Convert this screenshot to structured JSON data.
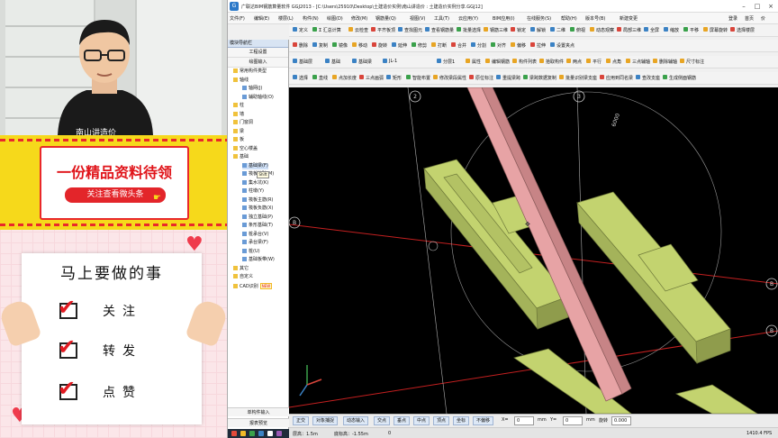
{
  "window": {
    "title": "广联达BIM钢筋算量软件 GGJ2013 - [C:\\Users\\25910\\Desktop\\土建造价实例\\南山讲造价 : 土建造价实例分享.GGJ12]",
    "controls": [
      "–",
      "□",
      "×"
    ]
  },
  "menu": [
    "文件(F)",
    "编辑(E)",
    "楼层(L)",
    "构件(N)",
    "绘图(D)",
    "修改(M)",
    "钢筋量(Q)",
    "视图(V)",
    "工具(T)",
    "云应用(Y)",
    "BIM应用(I)",
    "在线服务(S)",
    "帮助(H)",
    "版本号(B)",
    "新建变更"
  ],
  "menu_right": [
    "登录",
    "首页",
    "价"
  ],
  "toolbar1": [
    "定义",
    "Σ 汇总计算",
    "云检查",
    "平齐板顶",
    "查找图元",
    "查看钢筋量",
    "批量选择",
    "钢筋三维",
    "锁定",
    "解锁",
    "二维",
    "俯视",
    "动态观察",
    "局部三维",
    "全屏",
    "缩放",
    "平移",
    "屏幕旋转",
    "选择楼层"
  ],
  "toolbar2": [
    "删除",
    "复制",
    "镜像",
    "移动",
    "旋转",
    "延伸",
    "修剪",
    "打断",
    "合并",
    "分割",
    "对齐",
    "偏移",
    "拉伸",
    "设置夹点"
  ],
  "toolbar3": {
    "layer_label": "基础层",
    "category_label": "基础",
    "type_label": "基础梁",
    "item_value": "JL-1",
    "subtype_value": "分层1",
    "buttons": [
      "属性",
      "编辑钢筋",
      "构件列表",
      "拾取构件",
      "两点",
      "平行",
      "点角",
      "三点辅轴",
      "删除辅轴",
      "尺寸标注"
    ]
  },
  "toolbar4": [
    "选择",
    "直线",
    "点加长度",
    "三点画弧",
    "矩形",
    "智能布置",
    "修改梁段属性",
    "原位标注",
    "重提梁跨",
    "梁跨数据复制",
    "批量识别梁支座",
    "应用到同名梁",
    "查改支座",
    "生成侧面钢筋"
  ],
  "tree": {
    "header": "模块导航栏",
    "sections": [
      "工程设置",
      "绘图输入"
    ],
    "items": [
      {
        "label": "常用构件类型",
        "kind": "folder"
      },
      {
        "label": "轴线",
        "kind": "folder"
      },
      {
        "label": "轴网(J)",
        "kind": "item"
      },
      {
        "label": "辅助轴线(O)",
        "kind": "item"
      },
      {
        "label": "柱",
        "kind": "folder"
      },
      {
        "label": "墙",
        "kind": "folder"
      },
      {
        "label": "门窗洞",
        "kind": "folder"
      },
      {
        "label": "梁",
        "kind": "folder"
      },
      {
        "label": "板",
        "kind": "folder"
      },
      {
        "label": "空心楼盖",
        "kind": "folder"
      },
      {
        "label": "基础",
        "kind": "folder"
      },
      {
        "label": "基础梁(F)",
        "kind": "item",
        "selected": true
      },
      {
        "label": "筏板基础(M)",
        "kind": "item"
      },
      {
        "label": "集水坑(K)",
        "kind": "item"
      },
      {
        "label": "柱墩(Y)",
        "kind": "item"
      },
      {
        "label": "筏板主筋(R)",
        "kind": "item"
      },
      {
        "label": "筏板负筋(X)",
        "kind": "item"
      },
      {
        "label": "独立基础(P)",
        "kind": "item"
      },
      {
        "label": "条形基础(T)",
        "kind": "item"
      },
      {
        "label": "桩承台(V)",
        "kind": "item"
      },
      {
        "label": "承台梁(F)",
        "kind": "item"
      },
      {
        "label": "桩(U)",
        "kind": "item"
      },
      {
        "label": "基础板带(W)",
        "kind": "item"
      },
      {
        "label": "其它",
        "kind": "folder"
      },
      {
        "label": "自定义",
        "kind": "folder"
      },
      {
        "label": "CAD识别",
        "kind": "folder",
        "badge": "NEW"
      }
    ],
    "tooltip": "Shift",
    "footer": [
      "单构件输入",
      "报表预览"
    ]
  },
  "viewport": {
    "axis_labels": [
      "2",
      "3",
      "B",
      "B",
      "B"
    ],
    "dimension": "6000"
  },
  "status1": {
    "buttons": [
      "正交",
      "对象捕捉",
      "动态输入",
      "交点",
      "垂点",
      "中点",
      "顶点",
      "坐标",
      "不偏移"
    ],
    "x_label": "X=",
    "x_value": "0",
    "mm1": "mm",
    "y_label": "Y=",
    "y_value": "0",
    "mm2": "mm",
    "rotate_label": "旋转",
    "rotate_value": "0.000"
  },
  "status2": {
    "floor": "层高：1.5m",
    "bottom": "底标高：-1.55m",
    "value": "0",
    "fps": "1410.4 FPS"
  },
  "promo": {
    "title": "一份精品资料待领",
    "subtitle": "关注查看微头条"
  },
  "notes": {
    "heading": "马上要做的事",
    "items": [
      "关注",
      "转发",
      "点赞"
    ]
  },
  "webcam": {
    "shirt_text": "南山讲造价"
  },
  "colors": {
    "beam": "#e7a3a5",
    "footing": "#c3d36f",
    "accent_red": "#e21b22",
    "promo_yellow": "#f6d91b"
  }
}
